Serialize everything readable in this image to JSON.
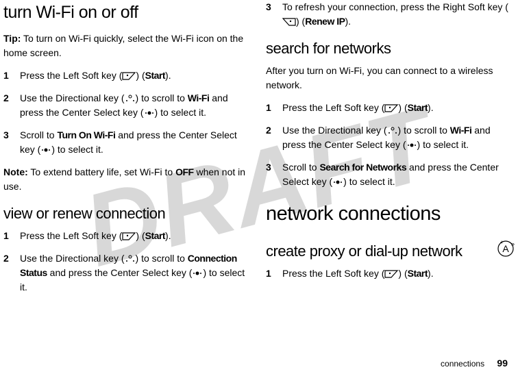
{
  "watermark": "DRAFT",
  "left_column": {
    "heading1": "turn Wi-Fi on or off",
    "tip_label": "Tip:",
    "tip_text": " To turn on Wi-Fi quickly, select the Wi-Fi icon on the home screen.",
    "step1": {
      "num": "1",
      "text_before": "Press the Left Soft key (",
      "text_after": ") (",
      "label": "Start",
      "text_end": ")."
    },
    "step2": {
      "num": "2",
      "text_before": "Use the Directional key (",
      "text_mid1": ") to scroll to ",
      "bold1": "Wi-Fi",
      "text_mid2": " and press the Center Select key (",
      "text_after": ") to select it."
    },
    "step3": {
      "num": "3",
      "text_before": "Scroll to ",
      "bold1": "Turn On Wi-Fi",
      "text_mid": " and press the Center Select key (",
      "text_after": ") to select it."
    },
    "note_label": "Note:",
    "note_text_before": " To extend battery life, set Wi-Fi to ",
    "note_bold": "OFF",
    "note_text_after": " when not in use.",
    "heading2": "view or renew connection",
    "step4": {
      "num": "1",
      "text_before": "Press the Left Soft key (",
      "text_after": ") (",
      "label": "Start",
      "text_end": ")."
    },
    "step5": {
      "num": "2",
      "text_before": "Use the Directional key (",
      "text_mid1": ") to scroll to ",
      "bold1": "Connection Status",
      "text_mid2": " and press the Center Select key (",
      "text_after": ") to select it."
    }
  },
  "right_column": {
    "step1": {
      "num": "3",
      "text_before": "To refresh your connection, press the Right Soft key (",
      "text_after": ") (",
      "label": "Renew IP",
      "text_end": ")."
    },
    "heading1": "search for networks",
    "body1": "After you turn on Wi-Fi, you can connect to a wireless network.",
    "step2": {
      "num": "1",
      "text_before": "Press the Left Soft key (",
      "text_after": ") (",
      "label": "Start",
      "text_end": ")."
    },
    "step3": {
      "num": "2",
      "text_before": "Use the Directional key (",
      "text_mid1": ") to scroll to ",
      "bold1": "Wi-Fi",
      "text_mid2": " and press the Center Select key (",
      "text_after": ") to select it."
    },
    "step4": {
      "num": "3",
      "text_before": "Scroll to ",
      "bold1": "Search for Networks",
      "text_mid": " and press the Center Select key (",
      "text_after": ") to select it."
    },
    "heading2": "network connections",
    "heading3": "create proxy or dial-up network",
    "step5": {
      "num": "1",
      "text_before": "Press the Left Soft key (",
      "text_after": ") (",
      "label": "Start",
      "text_end": ")."
    }
  },
  "footer": {
    "section": "connections",
    "page": "99"
  }
}
